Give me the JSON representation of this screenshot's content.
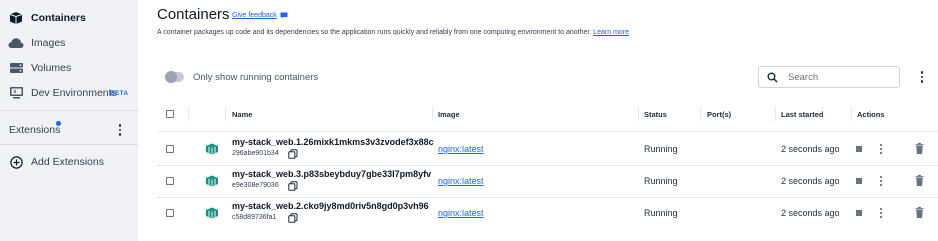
{
  "sidebar": {
    "items": [
      {
        "label": "Containers",
        "icon": "containers-icon",
        "active": true
      },
      {
        "label": "Images",
        "icon": "images-icon"
      },
      {
        "label": "Volumes",
        "icon": "volumes-icon"
      },
      {
        "label": "Dev Environments",
        "icon": "dev-environments-icon",
        "badge": "BETA"
      }
    ],
    "extensions_label": "Extensions",
    "add_extensions_label": "Add Extensions"
  },
  "header": {
    "title": "Containers",
    "feedback_label": "Give feedback",
    "description": "A container packages up code and its dependencies so the application runs quickly and reliably from one computing environment to another.",
    "learn_more": "Learn more"
  },
  "toolbar": {
    "toggle_label": "Only show running containers",
    "search_placeholder": "Search"
  },
  "table": {
    "columns": [
      "Name",
      "Image",
      "Status",
      "Port(s)",
      "Last started",
      "Actions"
    ],
    "rows": [
      {
        "name": "my-stack_web.1.26mixk1mkms3v3zvodef3x88c",
        "id": "296abe901b34",
        "image": "nginx:latest",
        "status": "Running",
        "ports": "",
        "last_started": "2 seconds ago"
      },
      {
        "name": "my-stack_web.3.p83sbeybduy7gbe33l7pm8yfv",
        "id": "e9e308e79036",
        "image": "nginx:latest",
        "status": "Running",
        "ports": "",
        "last_started": "2 seconds ago"
      },
      {
        "name": "my-stack_web.2.cko9jy8md0riv5n8gd0p3vh96",
        "id": "c58d89736fa1",
        "image": "nginx:latest",
        "status": "Running",
        "ports": "",
        "last_started": "2 seconds ago"
      }
    ]
  },
  "colors": {
    "accent": "#1d63ed",
    "container_icon": "#1a8f82",
    "sidebar_bg": "#f0f2f5"
  }
}
